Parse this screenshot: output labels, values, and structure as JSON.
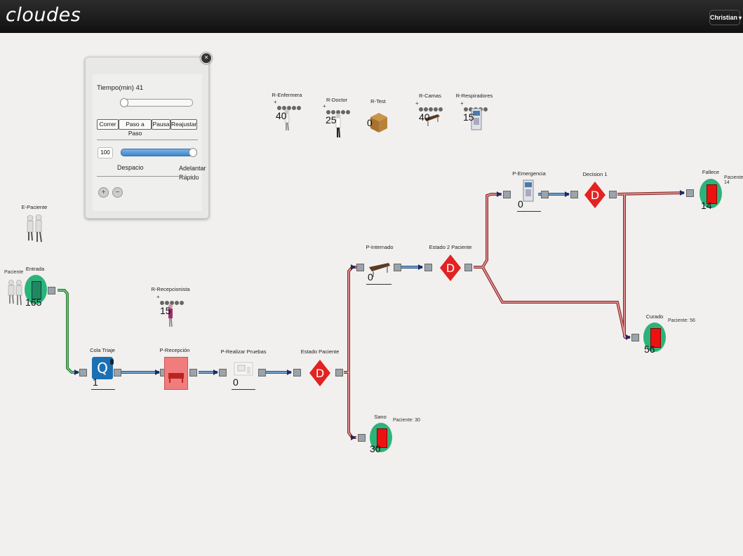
{
  "app": {
    "logo": "cloudes",
    "user": "Christian"
  },
  "icons": {
    "user_menu": "chevron-down-icon",
    "close": "close-icon",
    "zoom_in": "plus-icon",
    "zoom_out": "minus-icon"
  },
  "panel": {
    "time_label": "Tiempo(min)",
    "time_value": "41",
    "buttons": [
      "Correr",
      "Paso a Paso",
      "Pausa",
      "Reajustar"
    ],
    "speed_value": "100",
    "speed_slow": "Despacio",
    "speed_fast": "Adelantar Rápido"
  },
  "resources": [
    {
      "name": "R-Enfermera",
      "count": "40",
      "plus": "+"
    },
    {
      "name": "R-Doctor",
      "count": "25",
      "plus": "+"
    },
    {
      "name": "R-Test",
      "count": "0",
      "plus": ""
    },
    {
      "name": "R-Camas",
      "count": "40",
      "plus": "+"
    },
    {
      "name": "R-Respiradores",
      "count": "15",
      "plus": "+"
    },
    {
      "name": "R-Recepcionista",
      "count": "15",
      "plus": "+"
    }
  ],
  "nodes": {
    "e_paciente": {
      "label": "E-Paciente"
    },
    "entrada": {
      "label": "Entrada",
      "side": "Paciente",
      "count": "165"
    },
    "cola_triaje": {
      "label": "Cola Triaje",
      "count": "1",
      "icon": "Q"
    },
    "p_recepcion": {
      "label": "P-Recepción"
    },
    "p_pruebas": {
      "label": "P-Realizar Pruebas",
      "count": "0"
    },
    "estado_paciente": {
      "label": "Estado Paciente",
      "icon": "D"
    },
    "p_internado": {
      "label": "P-Internado",
      "count": "0"
    },
    "estado2": {
      "label": "Estado 2 Paciente",
      "icon": "D"
    },
    "p_emergencia": {
      "label": "P-Emergencia",
      "count": "0"
    },
    "decision1": {
      "label": "Decision 1",
      "icon": "D"
    },
    "fallece": {
      "label": "Fallece",
      "count": "14",
      "note": "Paciente: 14"
    },
    "curado": {
      "label": "Curado",
      "count": "56",
      "note": "Paciente: 56"
    },
    "sano": {
      "label": "Sano",
      "count": "30",
      "note": "Paciente: 30"
    }
  },
  "colors": {
    "topbar": "#1b1b1b",
    "canvas": "#f1f0ee",
    "flow_green": "#3aa04a",
    "flow_blue": "#3a6fb0",
    "flow_red": "#c44",
    "decision": "#e32222",
    "sink": "#2db37a"
  }
}
